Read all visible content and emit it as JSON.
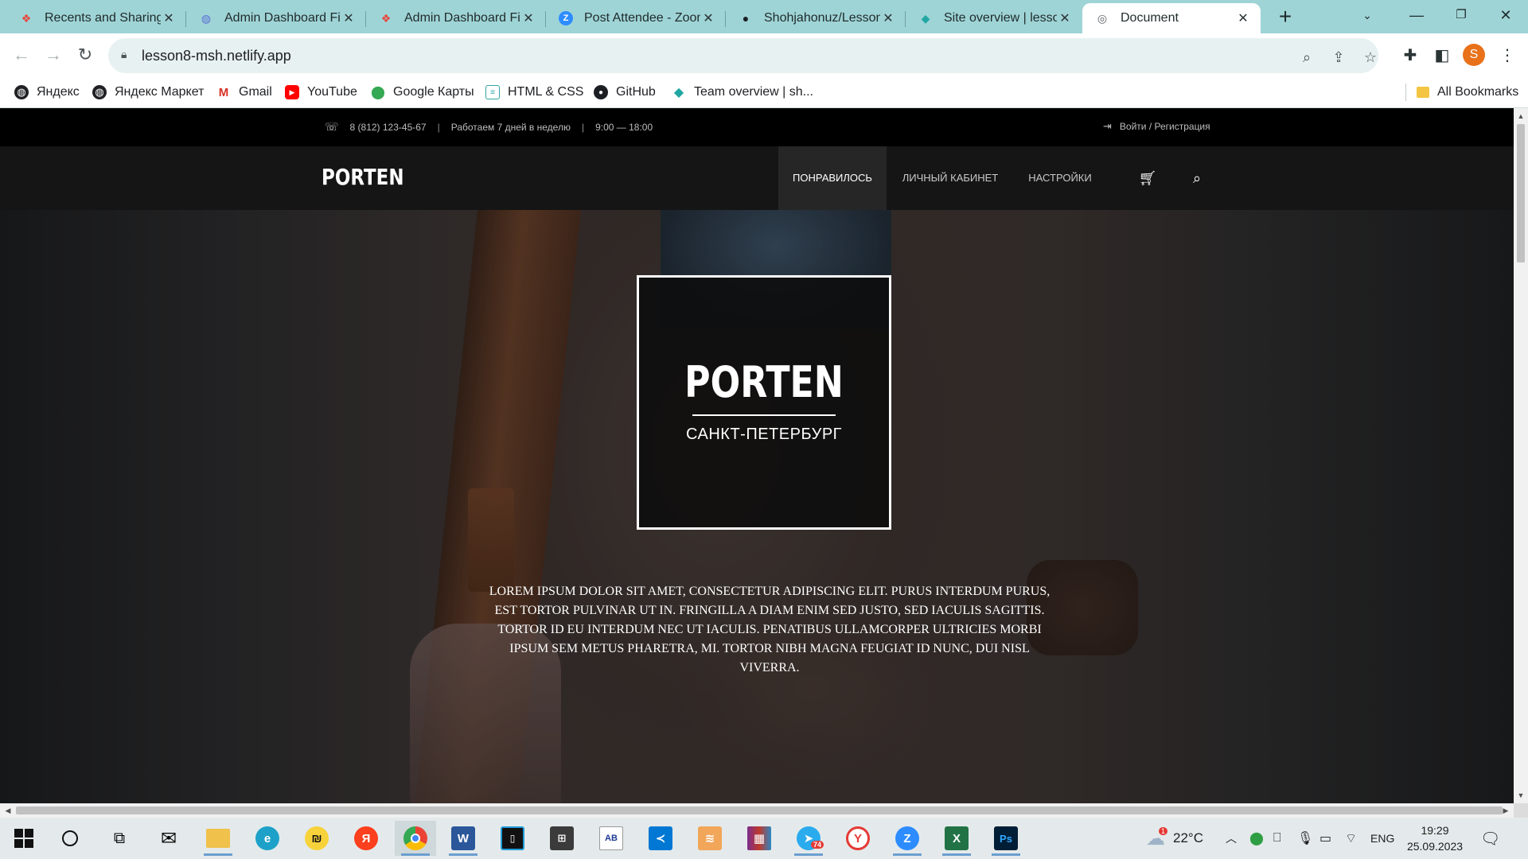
{
  "browser": {
    "tabs": [
      {
        "title": "Recents and Sharing -",
        "icon": "figma-icon",
        "glyph": "❖",
        "color": "#e8453c"
      },
      {
        "title": "Admin Dashboard Fit",
        "icon": "figma-circle-icon",
        "glyph": "◍",
        "color": "#5b6fd6"
      },
      {
        "title": "Admin Dashboard Fit",
        "icon": "figma-icon",
        "glyph": "❖",
        "color": "#e8453c"
      },
      {
        "title": "Post Attendee - Zoom",
        "icon": "zoom-icon",
        "glyph": "Z",
        "color": "#2d8cff"
      },
      {
        "title": "Shohjahonuz/Lesson-",
        "icon": "github-icon",
        "glyph": "●",
        "color": "#1b1f23"
      },
      {
        "title": "Site overview | lesson",
        "icon": "netlify-icon",
        "glyph": "◆",
        "color": "#20a7a3"
      },
      {
        "title": "Document",
        "icon": "globe-icon",
        "glyph": "◎",
        "color": "#5f6368"
      }
    ],
    "url": "lesson8-msh.netlify.app",
    "profile_initial": "S",
    "bookmarks": [
      {
        "label": "Яндекс",
        "icon": "globe-icon"
      },
      {
        "label": "Яндекс Маркет",
        "icon": "globe-icon"
      },
      {
        "label": "Gmail",
        "icon": "gmail-icon"
      },
      {
        "label": "YouTube",
        "icon": "youtube-icon"
      },
      {
        "label": "Google Карты",
        "icon": "maps-icon"
      },
      {
        "label": "HTML & CSS",
        "icon": "htmlacademy-icon"
      },
      {
        "label": "GitHub",
        "icon": "github-icon"
      },
      {
        "label": "Team overview | sh...",
        "icon": "netlify-icon"
      }
    ],
    "all_bookmarks": "All Bookmarks"
  },
  "site": {
    "topbar": {
      "phone": "8 (812) 123-45-67",
      "schedule": "Работаем 7 дней в неделю",
      "hours": "9:00 — 18:00",
      "login": "Войти / Регистрация"
    },
    "logo": "PORTEN",
    "nav": [
      {
        "label": "ПОНРАВИЛОСЬ",
        "active": true
      },
      {
        "label": "ЛИЧНЫЙ КАБИНЕТ",
        "active": false
      },
      {
        "label": "НАСТРОЙКИ",
        "active": false
      }
    ],
    "hero": {
      "brand": "PORTEN",
      "city": "САНКТ-ПЕТЕРБУРГ",
      "text": "Lorem ipsum dolor sit amet, consectetur adipiscing elit. Purus interdum purus, est tortor pulvinar ut in. Fringilla a diam enim sed justo, sed iaculis sagittis. Tortor id eu interdum nec ut iaculis. Penatibus ullamcorper ultricies morbi ipsum sem metus pharetra, mi. Tortor nibh magna feugiat id nunc, dui nisl viverra."
    }
  },
  "taskbar": {
    "weather": "22°C",
    "language": "ENG",
    "time": "19:29",
    "date": "25.09.2023",
    "telegram_badge": "74",
    "weather_badge": "1"
  },
  "colors": {
    "tabstrip": "#9fd4d6",
    "omnibox": "#e7f1f1",
    "site_topbar": "#000000",
    "site_nav": "#151515",
    "avatar": "#e8711a"
  }
}
